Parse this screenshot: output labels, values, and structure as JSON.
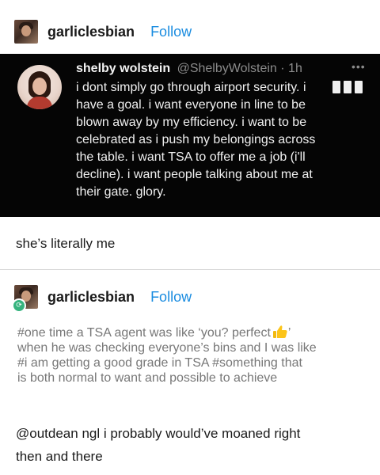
{
  "post": {
    "username": "garliclesbian",
    "follow_label": "Follow"
  },
  "tweet": {
    "display_name": "shelby wolstein",
    "handle_time": "@ShelbyWolstein · 1h",
    "more_icon": "ellipsis-icon",
    "lines": [
      "i dont simply go through airport security. i",
      "have a goal. i want everyone in line to be",
      "blown away by my efficiency. i want to be",
      "celebrated as i push my belongings across",
      "the table. i want TSA to offer me a job (i'll",
      "decline). i want people talking about me at",
      "their gate. glory."
    ]
  },
  "comment": "she’s literally me",
  "reblog": {
    "username": "garliclesbian",
    "follow_label": "Follow",
    "badge_icon": "reblog-icon",
    "lines": [
      "#one time a TSA agent was like ‘you? perfect",
      "when he was checking everyone’s bins and I was like",
      "#i am getting a good grade in TSA  #something that",
      "is both normal to want and possible to achieve"
    ],
    "line0_suffix": "’",
    "thumb_icon": "thumbs-up-emoji-icon"
  },
  "reply": {
    "mention": "@outdean",
    "line1_rest": " ngl i probably would’ve moaned right",
    "line2": "then and there"
  }
}
